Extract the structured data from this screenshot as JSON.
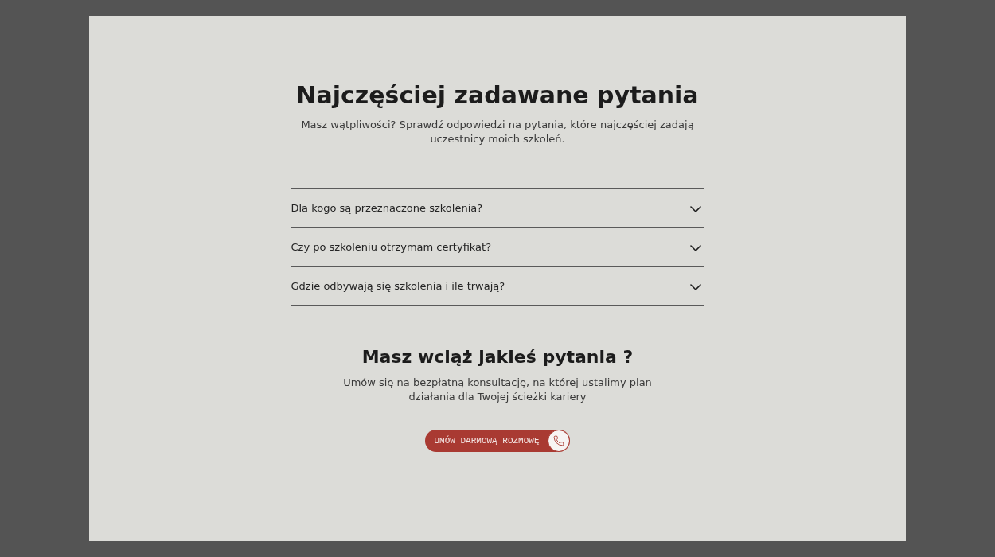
{
  "faq": {
    "title": "Najczęściej zadawane pytania",
    "subtitle": "Masz wątpliwości? Sprawdź odpowiedzi na pytania, które najczęściej zadają uczestnicy moich szkoleń.",
    "items": [
      {
        "question": "Dla kogo są przeznaczone szkolenia?",
        "expanded": false
      },
      {
        "question": "Czy po szkoleniu otrzymam certyfikat?",
        "expanded": false
      },
      {
        "question": "Gdzie odbywają się szkolenia i ile trwają?",
        "expanded": false
      }
    ]
  },
  "contact": {
    "title": "Masz wciąż jakieś pytania ?",
    "text": "Umów się na bezpłatną konsultację, na której ustalimy plan działania dla Twojej ścieżki kariery",
    "button": "UMÓW DARMOWĄ ROZMOWĘ"
  }
}
